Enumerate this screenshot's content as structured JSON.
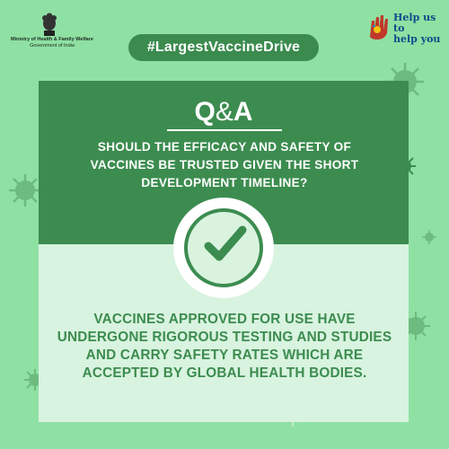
{
  "header": {
    "ministry_name": "Ministry of Health & Family Welfare",
    "ministry_sub": "Government of India",
    "help_line1": "Help us to",
    "help_line2": "help you",
    "emblem_icon": "national-emblem-icon",
    "help_icon": "hand-logo-icon"
  },
  "hashtag": "#LargestVaccineDrive",
  "qa": {
    "title_q": "Q",
    "title_amp": "&",
    "title_a": "A",
    "question": "SHOULD THE EFFICACY AND SAFETY OF VACCINES BE TRUSTED GIVEN THE SHORT DEVELOPMENT TIMELINE?",
    "answer": "VACCINES APPROVED FOR USE HAVE UNDERGONE RIGOROUS TESTING AND STUDIES AND CARRY SAFETY RATES WHICH ARE ACCEPTED BY GLOBAL HEALTH BODIES.",
    "check_icon": "checkmark-icon"
  },
  "colors": {
    "background": "#8fe0a3",
    "dark_green": "#3c8c4f",
    "light_green": "#d8f3df"
  }
}
